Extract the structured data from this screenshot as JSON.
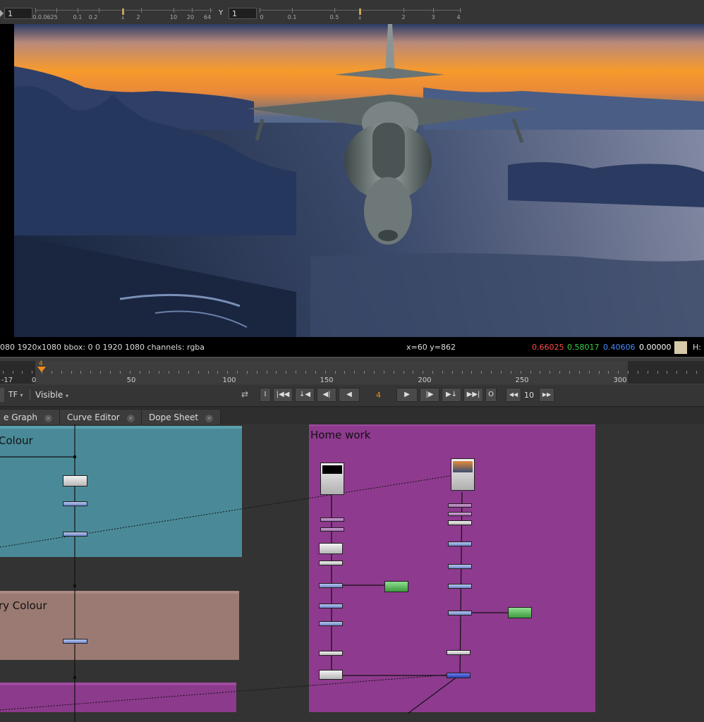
{
  "top_controls": {
    "x_value": "1",
    "y_label": "Y",
    "y_value": "1",
    "x_scale_labels": [
      "0.0.0625",
      "0.1",
      "0.2",
      "1",
      "2",
      "10",
      "20",
      "64"
    ],
    "y_scale_labels": [
      "0",
      "0.1",
      "0.5",
      "1",
      "2",
      "3",
      "4"
    ]
  },
  "viewer": {
    "format_info": "080 1920x1080  bbox: 0 0 1920 1080 channels: rgba",
    "cursor_position": "x=60 y=862",
    "pixel_r": "0.66025",
    "pixel_g": "0.58017",
    "pixel_b": "0.40606",
    "pixel_a": "0.00000",
    "hsv_label": "H:",
    "swatch_color": "#d6c8a8",
    "colors": {
      "r": "#ff4a4a",
      "g": "#35d04a",
      "b": "#4a8cff",
      "a": "#ffffff"
    }
  },
  "timeline": {
    "start_frame": "-17",
    "zero_label": "0",
    "current_frame_marker": "4",
    "labels": [
      "50",
      "100",
      "150",
      "200",
      "250",
      "300"
    ],
    "playhead_color": "#f08a1c"
  },
  "transport": {
    "tf_label": "TF",
    "visible_label": "Visible",
    "in_label": "I",
    "out_label": "O",
    "current_frame": "4",
    "increment": "10"
  },
  "tabs": [
    {
      "label": "e Graph"
    },
    {
      "label": "Curve Editor"
    },
    {
      "label": "Dope Sheet"
    }
  ],
  "node_graph": {
    "backdrops": [
      {
        "label": "Colour",
        "color": "#4a8a98"
      },
      {
        "label": "ry Colour",
        "color": "#9a7a72"
      },
      {
        "label": "",
        "color": "#8c3a8c"
      },
      {
        "label": "Home work",
        "color": "#8e3a8e"
      }
    ]
  }
}
